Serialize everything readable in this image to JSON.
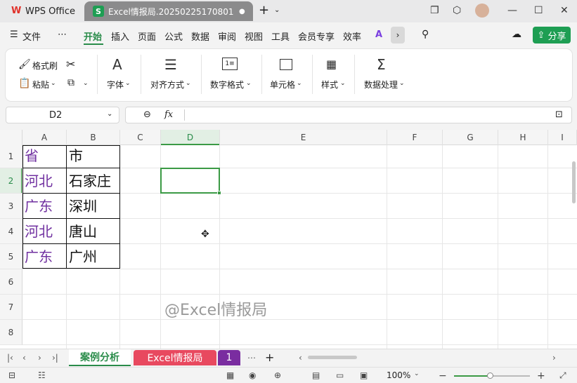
{
  "app": {
    "tab_label": "WPS Office",
    "doc_tab": "Excel情报局.20250225170801",
    "doc_icon_letter": "S",
    "tab_dot": "●"
  },
  "menu": {
    "file": "文件",
    "more": "⋯",
    "items": [
      "开始",
      "插入",
      "页面",
      "公式",
      "数据",
      "审阅",
      "视图",
      "工具",
      "会员专享",
      "效率"
    ],
    "active": "开始",
    "share": "分享"
  },
  "ribbon": {
    "format_painter": "格式刷",
    "paste": "粘贴",
    "font": "字体",
    "align": "对齐方式",
    "number_format": "数字格式",
    "cell": "单元格",
    "style": "样式",
    "data_process": "数据处理"
  },
  "formula_bar": {
    "name_box": "D2",
    "fx": "fx",
    "value": ""
  },
  "columns": [
    "A",
    "B",
    "C",
    "D",
    "E",
    "F",
    "G",
    "H",
    "I"
  ],
  "rows": [
    "1",
    "2",
    "3",
    "4",
    "5",
    "6",
    "7",
    "8"
  ],
  "cells": {
    "A1": "省",
    "B1": "市",
    "A2": "河北",
    "B2": "石家庄",
    "A3": "广东",
    "B3": "深圳",
    "A4": "河北",
    "B4": "唐山",
    "A5": "广东",
    "B5": "广州"
  },
  "watermark": "@Excel情报局",
  "sheets": [
    {
      "name": "案例分析",
      "active": true
    },
    {
      "name": "Excel情报局",
      "color": "#e8495f"
    },
    {
      "name": "1",
      "color": "#7a2da0"
    }
  ],
  "status": {
    "zoom": "100%"
  },
  "colors": {
    "accent": "#2a8c4a",
    "province": "#7030a0",
    "selection": "#3b9a45"
  }
}
